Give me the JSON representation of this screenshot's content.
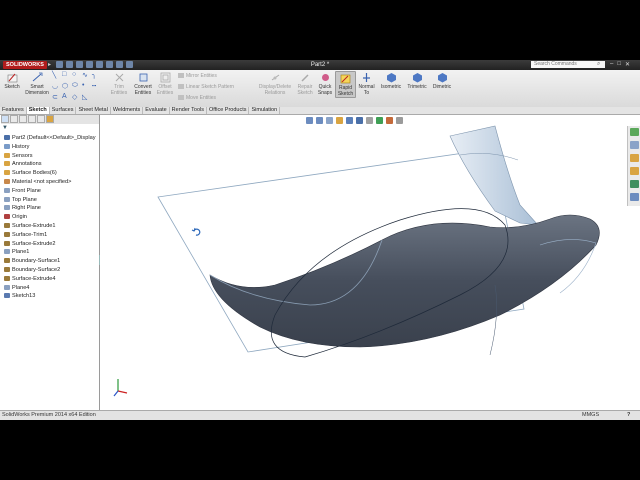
{
  "titlebar": {
    "brand": "SOLIDWORKS",
    "document_title": "Part2 *",
    "search_placeholder": "Search Commands",
    "window_minimize": "–",
    "window_restore": "□",
    "window_close": "✕"
  },
  "ribbon": {
    "sketch": "Sketch",
    "smart_dimension_line1": "Smart",
    "smart_dimension_line2": "Dimension",
    "trim_line1": "Trim",
    "trim_line2": "Entities",
    "convert_line1": "Convert",
    "convert_line2": "Entities",
    "offset_line1": "Offset",
    "offset_line2": "Entities",
    "mirror": "Mirror Entities",
    "linear_pattern": "Linear Sketch Pattern",
    "move": "Move Entities",
    "display_delete_line1": "Display/Delete",
    "display_delete_line2": "Relations",
    "repair_line1": "Repair",
    "repair_line2": "Sketch",
    "quick_snaps_line1": "Quick",
    "quick_snaps_line2": "Snaps",
    "rapid_sketch_line1": "Rapid",
    "rapid_sketch_line2": "Sketch",
    "normal_to_line1": "Normal",
    "normal_to_line2": "To",
    "isometric": "Isometric",
    "trimetric": "Trimetric",
    "dimetric": "Dimetric"
  },
  "tabs": [
    "Features",
    "Sketch",
    "Surfaces",
    "Sheet Metal",
    "Weldments",
    "Evaluate",
    "Render Tools",
    "Office Products",
    "Simulation"
  ],
  "active_tab": "Sketch",
  "tree": [
    {
      "label": "Part2  (Default<<Default>_Display",
      "icon_color": "#4a6fa8"
    },
    {
      "label": "History",
      "icon_color": "#7a9bc8"
    },
    {
      "label": "Sensors",
      "icon_color": "#d9a441"
    },
    {
      "label": "Annotations",
      "icon_color": "#d9a441"
    },
    {
      "label": "Surface Bodies(6)",
      "icon_color": "#d9a441"
    },
    {
      "label": "Material <not specified>",
      "icon_color": "#c8884a"
    },
    {
      "label": "Front Plane",
      "icon_color": "#8aa0c0"
    },
    {
      "label": "Top Plane",
      "icon_color": "#8aa0c0"
    },
    {
      "label": "Right Plane",
      "icon_color": "#8aa0c0"
    },
    {
      "label": "Origin",
      "icon_color": "#b04040"
    },
    {
      "label": "Surface-Extrude1",
      "icon_color": "#9a7a3a"
    },
    {
      "label": "Surface-Trim1",
      "icon_color": "#9a7a3a"
    },
    {
      "label": "Surface-Extrude2",
      "icon_color": "#9a7a3a"
    },
    {
      "label": "Plane1",
      "icon_color": "#8aa0c0"
    },
    {
      "label": "Boundary-Surface1",
      "icon_color": "#9a7a3a"
    },
    {
      "label": "Boundary-Surface2",
      "icon_color": "#9a7a3a"
    },
    {
      "label": "Surface-Extrude4",
      "icon_color": "#9a7a3a"
    },
    {
      "label": "Plane4",
      "icon_color": "#8aa0c0"
    },
    {
      "label": "Sketch13",
      "icon_color": "#5a7ab0"
    }
  ],
  "status": {
    "edition": "SolidWorks Premium 2014 x64 Edition",
    "units": "MMGS",
    "help": "?"
  },
  "colors": {
    "titlebar": "#2a2a2a",
    "surface": "#4a5260",
    "surface_highlight": "#9ab0c8",
    "plane_edge": "#8fa8c0",
    "ribbon_active": "#c8c8c8"
  }
}
